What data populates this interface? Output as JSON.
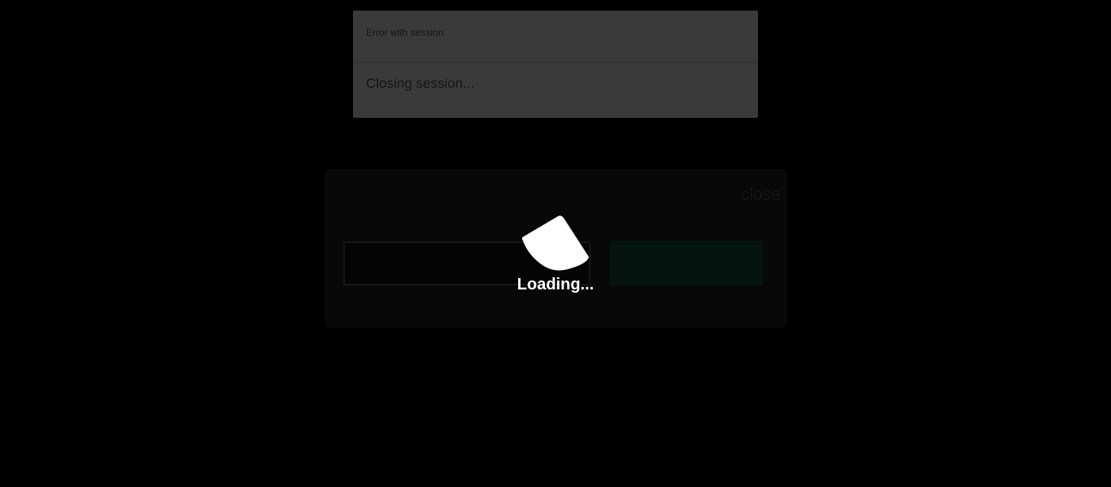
{
  "notification": {
    "title": "Error with session.",
    "message": "Closing session..."
  },
  "dialog": {
    "close_label": "close",
    "input_value": "",
    "button_label": ""
  },
  "loading": {
    "label": "Loading...",
    "icon": "spinner-icon"
  },
  "colors": {
    "background": "#000000",
    "notification_bg": "#3a3a3a",
    "loading_text": "#ffffff"
  }
}
